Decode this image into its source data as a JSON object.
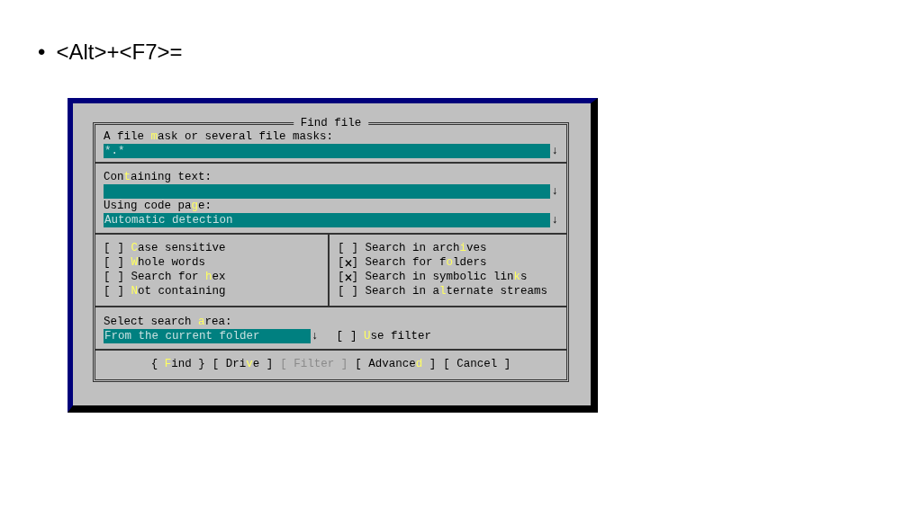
{
  "slide": {
    "bullet": "•",
    "heading": "<Alt>+<F7>="
  },
  "dialog": {
    "title": "Find file",
    "mask": {
      "label": {
        "before": "A file ",
        "hot": "m",
        "after": "ask or several file masks:"
      },
      "value": "*.*",
      "arrow": "↓"
    },
    "text": {
      "label": {
        "before": "Con",
        "hot": "t",
        "after": "aining text:"
      },
      "arrow": "↓"
    },
    "codepage": {
      "label": {
        "before": "Using code pa",
        "hot": "g",
        "after": "e:"
      },
      "value": "Automatic detection",
      "arrow": "↓"
    },
    "options_left": [
      {
        "open": "[",
        "close": "]",
        "checked": false,
        "label": {
          "hot": "C",
          "after": "ase sensitive"
        }
      },
      {
        "open": "[",
        "close": "]",
        "checked": false,
        "label": {
          "hot": "W",
          "after": "hole words"
        }
      },
      {
        "open": "[",
        "close": "]",
        "checked": false,
        "label": {
          "before": "Search for ",
          "hot": "h",
          "after": "ex"
        }
      },
      {
        "open": "[",
        "close": "]",
        "checked": false,
        "label": {
          "hot": "N",
          "after": "ot containing"
        }
      }
    ],
    "options_right": [
      {
        "open": "[",
        "close": "]",
        "checked": false,
        "label": {
          "before": "Search in arch",
          "hot": "i",
          "after": "ves"
        }
      },
      {
        "open": "[",
        "close": "]",
        "checked": true,
        "label": {
          "before": "Search for f",
          "hot": "o",
          "after": "lders"
        }
      },
      {
        "open": "[",
        "close": "]",
        "checked": true,
        "label": {
          "before": "Search in symbolic lin",
          "hot": "k",
          "after": "s"
        }
      },
      {
        "open": "[",
        "close": "]",
        "checked": false,
        "label": {
          "before": "Search in a",
          "hot": "l",
          "after": "ternate streams"
        }
      }
    ],
    "area": {
      "label": {
        "before": "Select search ",
        "hot": "a",
        "after": "rea:"
      },
      "value": "From the current folder",
      "arrow": "↓"
    },
    "filter": {
      "open": "[",
      "close": "]",
      "checked": false,
      "label": {
        "hot": "U",
        "after": "se filter"
      }
    },
    "buttons": [
      {
        "before": "{ ",
        "hot": "F",
        "after": "ind }",
        "disabled": false
      },
      {
        "before": "[ Dri",
        "hot": "v",
        "after": "e ]",
        "disabled": false
      },
      {
        "before": "[ Filter ]",
        "disabled": true
      },
      {
        "before": "[ Advance",
        "hot": "d",
        "after": " ]",
        "disabled": false
      },
      {
        "before": "[ Cancel ]",
        "disabled": false
      }
    ]
  }
}
